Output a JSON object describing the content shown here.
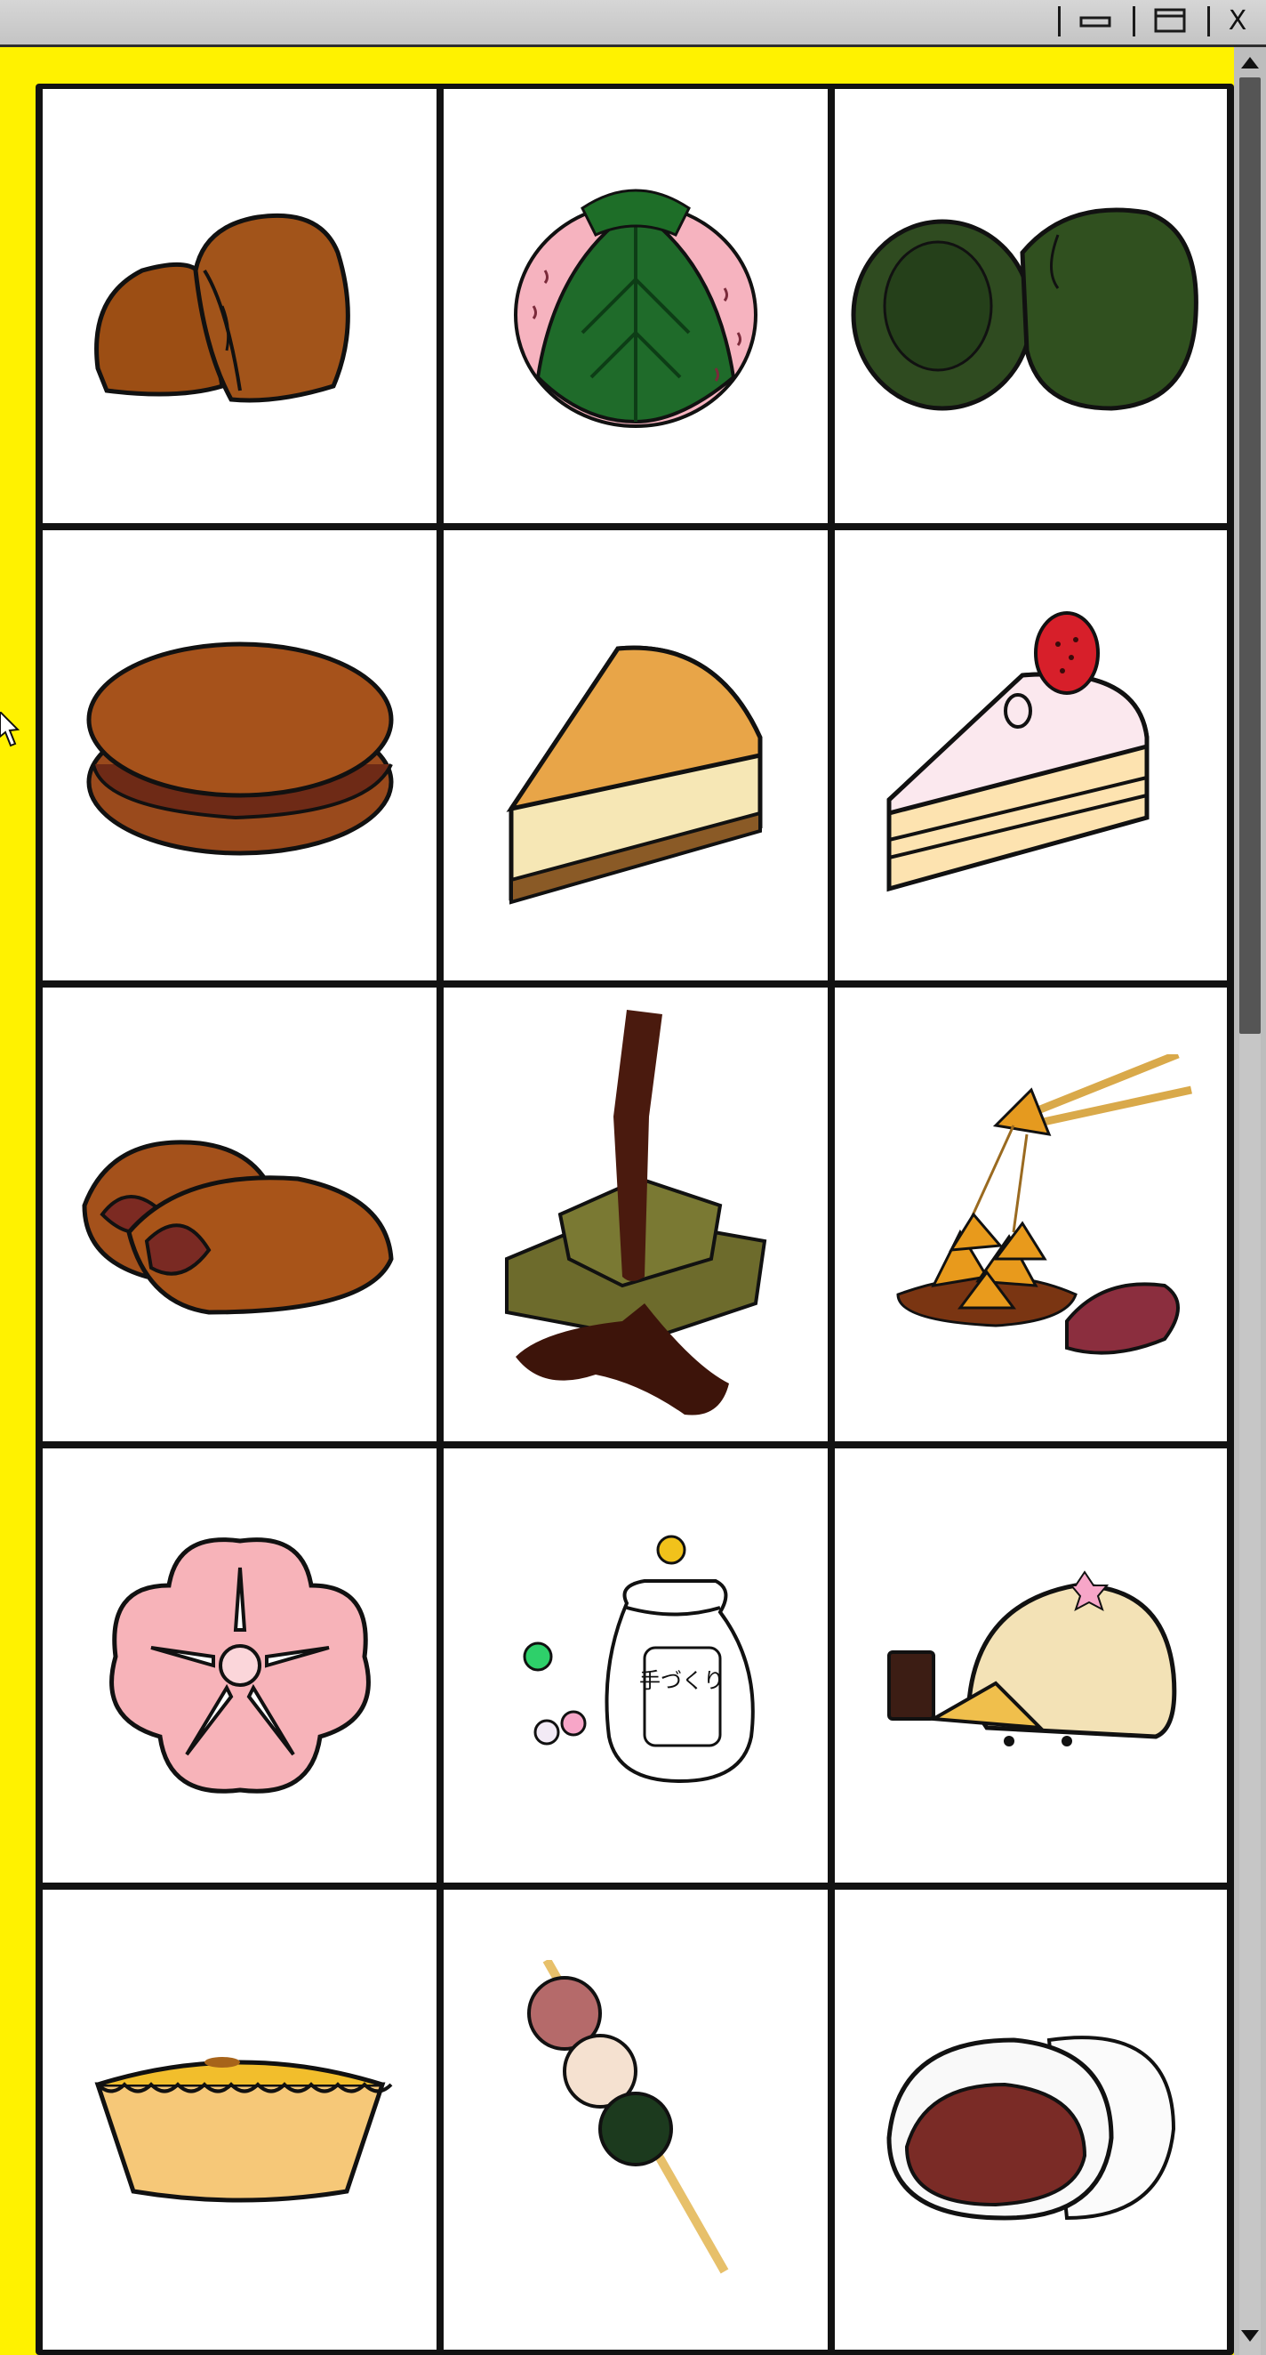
{
  "window": {
    "controls": [
      "minimize",
      "maximize",
      "close"
    ],
    "close_glyph": "X"
  },
  "colors": {
    "frame_yellow": "#fff200",
    "titlebar": "#c9c9c9",
    "scroll_thumb": "#555555",
    "cell_border": "#121212"
  },
  "scrollbar": {
    "thumb_fraction": 0.42,
    "position_fraction": 0.0
  },
  "gallery": {
    "columns": 3,
    "rows": 5,
    "items": [
      {
        "icon": "baked-manju-icon"
      },
      {
        "icon": "sakura-mochi-icon"
      },
      {
        "icon": "kusa-mochi-icon"
      },
      {
        "icon": "dorayaki-icon"
      },
      {
        "icon": "cheesecake-slice-icon"
      },
      {
        "icon": "strawberry-shortcake-icon"
      },
      {
        "icon": "taiyaki-icon"
      },
      {
        "icon": "warabi-mochi-icon"
      },
      {
        "icon": "candied-sweet-potato-icon"
      },
      {
        "icon": "plum-blossom-wagashi-icon"
      },
      {
        "icon": "konpeito-bag-icon",
        "bag_label": "手づくり"
      },
      {
        "icon": "sakura-daifuku-cheese-icon"
      },
      {
        "icon": "egg-tart-icon"
      },
      {
        "icon": "dango-skewer-icon"
      },
      {
        "icon": "daifuku-icon"
      }
    ]
  }
}
